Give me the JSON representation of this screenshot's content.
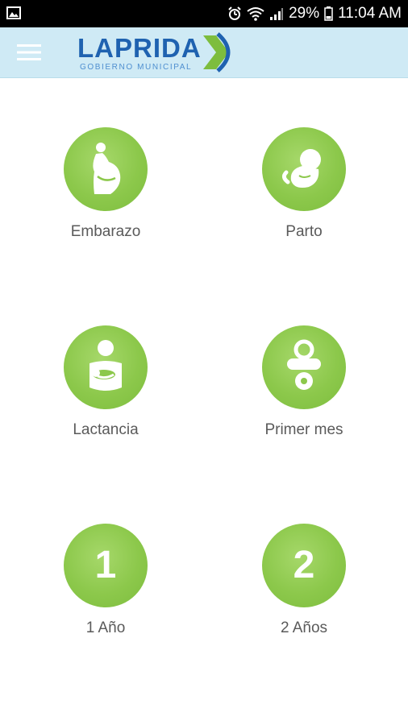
{
  "status_bar": {
    "battery": "29%",
    "time": "11:04 AM",
    "icons": [
      "gallery-icon",
      "alarm-icon",
      "wifi-icon",
      "signal-icon",
      "battery-icon"
    ]
  },
  "header": {
    "menu_icon": "hamburger-menu-icon",
    "logo_title": "LAPRIDA",
    "logo_subtitle": "GOBIERNO MUNICIPAL",
    "brand_colors": {
      "blue": "#1f62b0",
      "green": "#7dbd3e",
      "bar": "#cfeaf5"
    }
  },
  "menu": {
    "circle_color": "#8cc84b",
    "items": [
      {
        "label": "Embarazo",
        "icon": "pregnancy-icon"
      },
      {
        "label": "Parto",
        "icon": "fetus-icon"
      },
      {
        "label": "Lactancia",
        "icon": "breastfeeding-icon"
      },
      {
        "label": "Primer mes",
        "icon": "pacifier-icon"
      },
      {
        "label": "1 Año",
        "icon": "number-one-icon",
        "glyph": "1"
      },
      {
        "label": "2 Años",
        "icon": "number-two-icon",
        "glyph": "2"
      }
    ]
  }
}
